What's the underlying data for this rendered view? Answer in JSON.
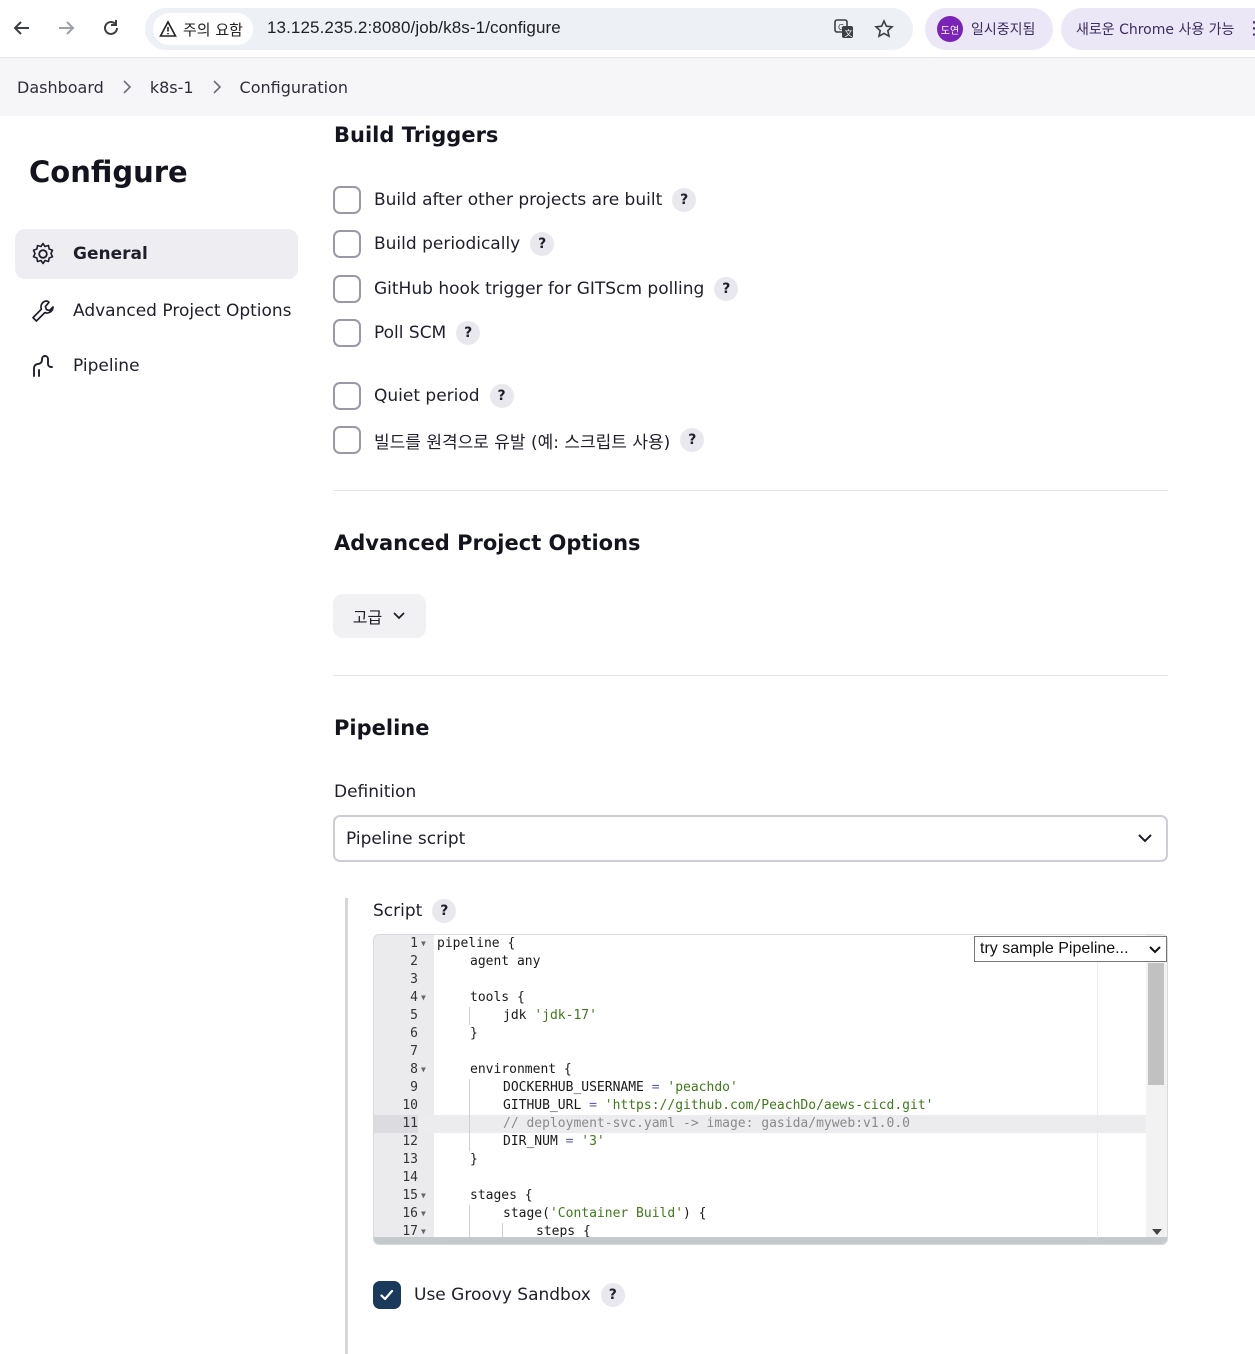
{
  "browser": {
    "security_chip": "주의 요함",
    "url": "13.125.235.2:8080/job/k8s-1/configure",
    "profile_avatar": "도연",
    "profile_status": "일시중지됨",
    "update_label": "새로운 Chrome 사용 가능"
  },
  "breadcrumb": {
    "items": [
      "Dashboard",
      "k8s-1",
      "Configuration"
    ]
  },
  "sidebar": {
    "title": "Configure",
    "items": [
      {
        "label": "General",
        "icon": "gear-icon",
        "active": true
      },
      {
        "label": "Advanced Project Options",
        "icon": "wrench-icon",
        "active": false
      },
      {
        "label": "Pipeline",
        "icon": "pipeline-icon",
        "active": false
      }
    ]
  },
  "build_triggers": {
    "title": "Build Triggers",
    "options": [
      {
        "label": "Build after other projects are built",
        "checked": false
      },
      {
        "label": "Build periodically",
        "checked": false
      },
      {
        "label": "GitHub hook trigger for GITScm polling",
        "checked": false
      },
      {
        "label": "Poll SCM",
        "checked": false
      },
      {
        "label": "Quiet period",
        "checked": false
      },
      {
        "label": "빌드를 원격으로 유발 (예: 스크립트 사용)",
        "checked": false
      }
    ],
    "help_glyph": "?"
  },
  "advanced": {
    "title": "Advanced Project Options",
    "button_label": "고급"
  },
  "pipeline": {
    "title": "Pipeline",
    "definition_label": "Definition",
    "definition_value": "Pipeline script",
    "script_label": "Script",
    "sample_select": "try sample Pipeline...",
    "highlighted_line": 11,
    "code_lines": [
      {
        "n": "1",
        "fold": true,
        "indent": 0,
        "parts": [
          [
            "t",
            "pipeline {"
          ]
        ]
      },
      {
        "n": "2",
        "fold": false,
        "indent": 1,
        "parts": [
          [
            "t",
            "agent any"
          ]
        ]
      },
      {
        "n": "3",
        "fold": false,
        "indent": 0,
        "parts": []
      },
      {
        "n": "4",
        "fold": true,
        "indent": 1,
        "parts": [
          [
            "t",
            "tools {"
          ]
        ]
      },
      {
        "n": "5",
        "fold": false,
        "indent": 2,
        "parts": [
          [
            "t",
            "jdk "
          ],
          [
            "s",
            "'jdk-17'"
          ]
        ]
      },
      {
        "n": "6",
        "fold": false,
        "indent": 1,
        "parts": [
          [
            "t",
            "}"
          ]
        ]
      },
      {
        "n": "7",
        "fold": false,
        "indent": 0,
        "parts": []
      },
      {
        "n": "8",
        "fold": true,
        "indent": 1,
        "parts": [
          [
            "t",
            "environment {"
          ]
        ]
      },
      {
        "n": "9",
        "fold": false,
        "indent": 2,
        "parts": [
          [
            "t",
            "DOCKERHUB_USERNAME "
          ],
          [
            "o",
            "="
          ],
          [
            "t",
            " "
          ],
          [
            "s",
            "'peachdo'"
          ]
        ]
      },
      {
        "n": "10",
        "fold": false,
        "indent": 2,
        "parts": [
          [
            "t",
            "GITHUB_URL "
          ],
          [
            "o",
            "="
          ],
          [
            "t",
            " "
          ],
          [
            "s",
            "'https://github.com/PeachDo/aews-cicd.git'"
          ]
        ]
      },
      {
        "n": "11",
        "fold": false,
        "indent": 2,
        "parts": [
          [
            "c",
            "// deployment-svc.yaml -> image: gasida/myweb:v1.0.0"
          ]
        ]
      },
      {
        "n": "12",
        "fold": false,
        "indent": 2,
        "parts": [
          [
            "t",
            "DIR_NUM "
          ],
          [
            "o",
            "="
          ],
          [
            "t",
            " "
          ],
          [
            "s",
            "'3'"
          ]
        ]
      },
      {
        "n": "13",
        "fold": false,
        "indent": 1,
        "parts": [
          [
            "t",
            "}"
          ]
        ]
      },
      {
        "n": "14",
        "fold": false,
        "indent": 0,
        "parts": []
      },
      {
        "n": "15",
        "fold": true,
        "indent": 1,
        "parts": [
          [
            "t",
            "stages {"
          ]
        ]
      },
      {
        "n": "16",
        "fold": true,
        "indent": 2,
        "parts": [
          [
            "t",
            "stage("
          ],
          [
            "s",
            "'Container Build'"
          ],
          [
            "t",
            ") {"
          ]
        ]
      },
      {
        "n": "17",
        "fold": true,
        "indent": 3,
        "parts": [
          [
            "t",
            "steps {"
          ]
        ]
      }
    ],
    "sandbox_label": "Use Groovy Sandbox",
    "sandbox_checked": true
  }
}
